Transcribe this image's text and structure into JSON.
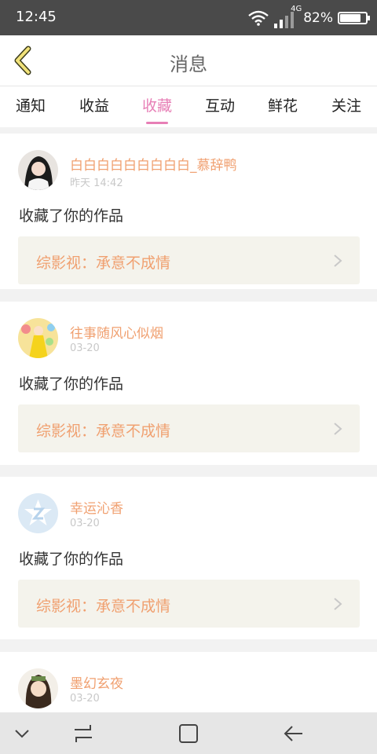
{
  "status": {
    "time": "12:45",
    "network": "4G",
    "battery_text": "82%",
    "battery_level": 0.82
  },
  "header": {
    "title": "消息"
  },
  "tabs": [
    {
      "label": "通知",
      "active": false
    },
    {
      "label": "收益",
      "active": false
    },
    {
      "label": "收藏",
      "active": true
    },
    {
      "label": "互动",
      "active": false
    },
    {
      "label": "鲜花",
      "active": false
    },
    {
      "label": "关注",
      "active": false
    }
  ],
  "messages": [
    {
      "user": "白白白白白白白白白_慕辞鸭",
      "time": "昨天 14:42",
      "action": "收藏了你的作品",
      "work": "综影视：承意不成情",
      "avatar_icon": "user-avatar-icon"
    },
    {
      "user": "往事随风心似烟",
      "time": "03-20",
      "action": "收藏了你的作品",
      "work": "综影视：承意不成情",
      "avatar_icon": "user-avatar-icon"
    },
    {
      "user": "幸运沁香",
      "time": "03-20",
      "action": "收藏了你的作品",
      "work": "综影视：承意不成情",
      "avatar_icon": "default-avatar-icon"
    },
    {
      "user": "墨幻玄夜",
      "time": "03-20",
      "action": "",
      "work": "",
      "avatar_icon": "user-avatar-icon"
    }
  ],
  "colors": {
    "accent": "#e77fb6",
    "username": "#f0a070",
    "back_arrow": "#f1e27a"
  }
}
